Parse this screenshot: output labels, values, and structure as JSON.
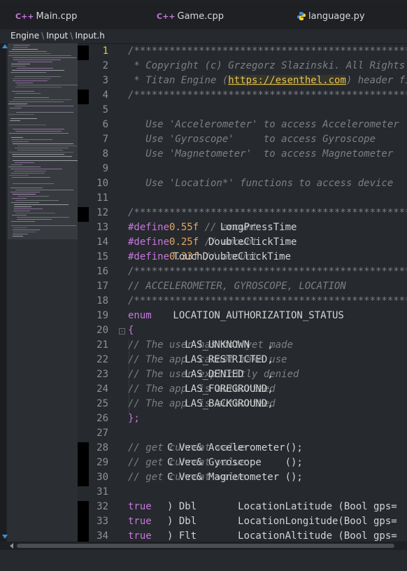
{
  "tabs": [
    {
      "label": "Main.cpp",
      "icon": "cpp-file-icon",
      "icon_text": "C++",
      "color": "#c678dd"
    },
    {
      "label": "Game.cpp",
      "icon": "cpp-file-icon",
      "icon_text": "C++",
      "color": "#c678dd"
    },
    {
      "label": "language.py",
      "icon": "python-file-icon",
      "color": "#4b8bbe"
    }
  ],
  "breadcrumb": [
    "Engine",
    "Input",
    "Input.h"
  ],
  "editor": {
    "current_line": 1,
    "colors": {
      "keyword": "#c678dd",
      "number": "#e5a862",
      "comment": "#7c7f84",
      "url": "#e8c44a",
      "text": "#d4d4d4"
    },
    "lines": [
      {
        "n": "1",
        "segs": [
          [
            "com",
            "/******************************************************************************"
          ]
        ]
      },
      {
        "n": "2",
        "segs": [
          [
            "com",
            " * Copyright (c) Grzegorz Slazinski. All Rights Reserved."
          ]
        ]
      },
      {
        "n": "3",
        "segs": [
          [
            "com",
            " * Titan Engine ("
          ],
          [
            "url",
            "https://esenthel.com"
          ],
          [
            "com",
            ") header file."
          ]
        ]
      },
      {
        "n": "4",
        "segs": [
          [
            "com",
            "/******************************************************************************"
          ]
        ]
      },
      {
        "n": "5",
        "segs": []
      },
      {
        "n": "6",
        "segs": [
          [
            "com",
            "   Use 'Accelerometer' to access Accelerometer"
          ]
        ]
      },
      {
        "n": "7",
        "segs": [
          [
            "com",
            "   Use 'Gyroscope'     to access Gyroscope"
          ]
        ]
      },
      {
        "n": "8",
        "segs": [
          [
            "com",
            "   Use 'Magnetometer'  to access Magnetometer"
          ]
        ]
      },
      {
        "n": "9",
        "segs": []
      },
      {
        "n": "10",
        "segs": [
          [
            "com",
            "   Use 'Location*' functions to access device"
          ]
        ]
      },
      {
        "n": "11",
        "segs": []
      },
      {
        "n": "12",
        "segs": [
          [
            "com",
            "/******************************************************************************"
          ]
        ]
      },
      {
        "n": "13",
        "segs": [
          [
            "kw",
            "#define"
          ],
          [
            "txt",
            "         LongPressTime "
          ],
          [
            "num",
            "0.55f"
          ],
          [
            "com",
            " // amount"
          ]
        ]
      },
      {
        "n": "14",
        "segs": [
          [
            "kw",
            "#define"
          ],
          [
            "txt",
            "       DoubleClickTime "
          ],
          [
            "num",
            "0.25f"
          ],
          [
            "com",
            " // amount"
          ]
        ]
      },
      {
        "n": "15",
        "segs": [
          [
            "kw",
            "#define"
          ],
          [
            "txt",
            " TouchDoubleClickTime "
          ],
          [
            "num",
            "0.33f"
          ],
          [
            "com",
            " // amount"
          ]
        ]
      },
      {
        "n": "16",
        "segs": [
          [
            "com",
            "/******************************************************************************"
          ]
        ]
      },
      {
        "n": "17",
        "segs": [
          [
            "com",
            "// ACCELEROMETER, GYROSCOPE, LOCATION"
          ]
        ]
      },
      {
        "n": "18",
        "segs": [
          [
            "com",
            "/******************************************************************************"
          ]
        ]
      },
      {
        "n": "19",
        "segs": [
          [
            "kw",
            "enum"
          ],
          [
            "txt",
            " LOCATION_AUTHORIZATION_STATUS"
          ]
        ]
      },
      {
        "n": "20",
        "segs": [
          [
            "kw",
            "{"
          ]
        ]
      },
      {
        "n": "21",
        "segs": [
          [
            "txt",
            "   LAS_UNKNOWN   , "
          ],
          [
            "com",
            "// The user has not yet made"
          ]
        ]
      },
      {
        "n": "22",
        "segs": [
          [
            "txt",
            "   LAS_RESTRICTED, "
          ],
          [
            "com",
            "// The app  cannot make use"
          ]
        ]
      },
      {
        "n": "23",
        "segs": [
          [
            "txt",
            "   LAS_DENIED    , "
          ],
          [
            "com",
            "// The user explicitly denied"
          ]
        ]
      },
      {
        "n": "24",
        "segs": [
          [
            "txt",
            "   LAS_FOREGROUND, "
          ],
          [
            "com",
            "// The app  is authorized"
          ]
        ]
      },
      {
        "n": "25",
        "segs": [
          [
            "txt",
            "   LAS_BACKGROUND, "
          ],
          [
            "com",
            "// The app  is authorized"
          ]
        ]
      },
      {
        "n": "26",
        "segs": [
          [
            "kw",
            "};"
          ]
        ]
      },
      {
        "n": "27",
        "segs": []
      },
      {
        "n": "28",
        "segs": [
          [
            "txt",
            "C Vec& Accelerometer(); "
          ],
          [
            "com",
            "// get current value"
          ]
        ]
      },
      {
        "n": "29",
        "segs": [
          [
            "txt",
            "C Vec& Gyroscope    (); "
          ],
          [
            "com",
            "// get current value"
          ]
        ]
      },
      {
        "n": "30",
        "segs": [
          [
            "txt",
            "C Vec& Magnetometer (); "
          ],
          [
            "com",
            "// get current value"
          ]
        ]
      },
      {
        "n": "31",
        "segs": []
      },
      {
        "n": "32",
        "segs": [
          [
            "txt",
            "  Dbl       LocationLatitude (Bool gps="
          ],
          [
            "kw",
            "true"
          ],
          [
            "txt",
            ")"
          ]
        ]
      },
      {
        "n": "33",
        "segs": [
          [
            "txt",
            "  Dbl       LocationLongitude(Bool gps="
          ],
          [
            "kw",
            "true"
          ],
          [
            "txt",
            ")"
          ]
        ]
      },
      {
        "n": "34",
        "segs": [
          [
            "txt",
            "  Flt       LocationAltitude (Bool gps="
          ],
          [
            "kw",
            "true"
          ],
          [
            "txt",
            ")"
          ]
        ]
      }
    ]
  }
}
